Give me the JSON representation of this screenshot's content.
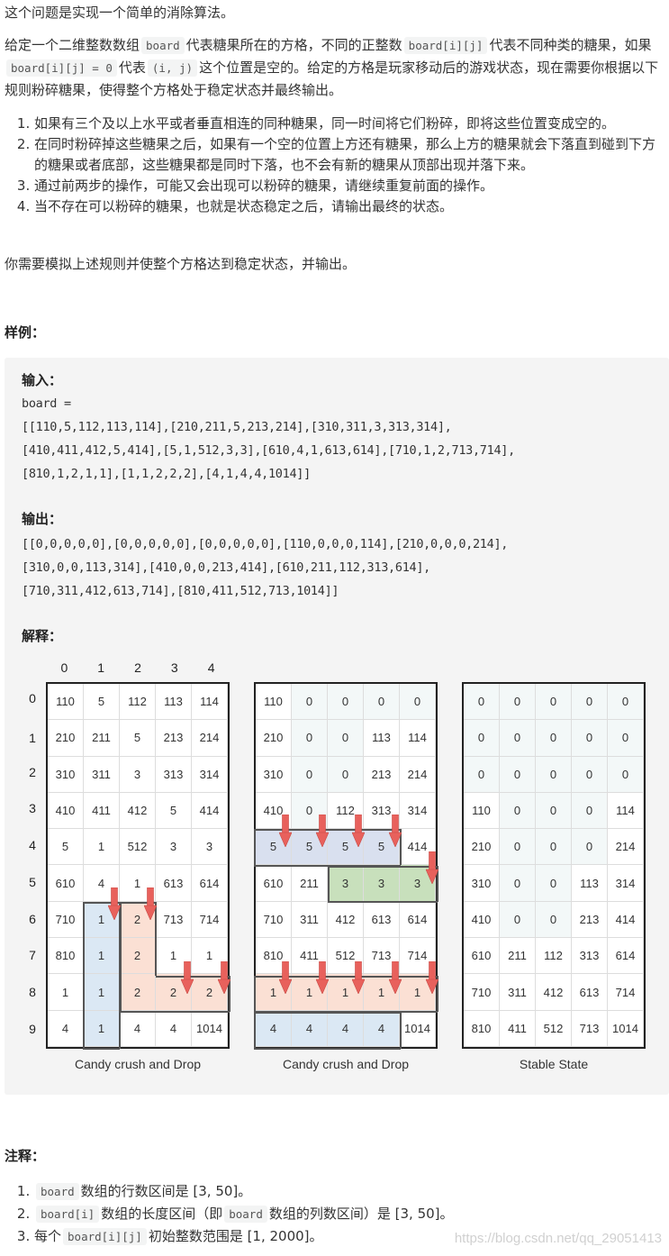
{
  "intro": "这个问题是实现一个简单的消除算法。",
  "desc": {
    "p1": "给定一个二维整数数组",
    "code_board": "board",
    "p2": "代表糖果所在的方格，不同的正整数",
    "code_bij": "board[i][j]",
    "p3": "代表不同种类的糖果，如果",
    "code_eq0": "board[i][j] = 0",
    "p4": "代表",
    "code_ij": "(i, j)",
    "p5": "这个位置是空的。给定的方格是玩家移动后的游戏状态，现在需要你根据以下规则粉碎糖果，使得整个方格处于稳定状态并最终输出。"
  },
  "rules": [
    "如果有三个及以上水平或者垂直相连的同种糖果，同一时间将它们粉碎，即将这些位置变成空的。",
    "在同时粉碎掉这些糖果之后，如果有一个空的位置上方还有糖果，那么上方的糖果就会下落直到碰到下方的糖果或者底部，这些糖果都是同时下落，也不会有新的糖果从顶部出现并落下来。",
    "通过前两步的操作，可能又会出现可以粉碎的糖果，请继续重复前面的操作。",
    "当不存在可以粉碎的糖果，也就是状态稳定之后，请输出最终的状态。"
  ],
  "summary": "你需要模拟上述规则并使整个方格达到稳定状态，并输出。",
  "example_heading": "样例：",
  "example": {
    "input_label": "输入：",
    "input_lines": [
      "board =",
      "[[110,5,112,113,114],[210,211,5,213,214],[310,311,3,313,314],",
      "[410,411,412,5,414],[5,1,512,3,3],[610,4,1,613,614],[710,1,2,713,714],",
      "[810,1,2,1,1],[1,1,2,2,2],[4,1,4,4,1014]]"
    ],
    "output_label": "输出：",
    "output_lines": [
      "[[0,0,0,0,0],[0,0,0,0,0],[0,0,0,0,0],[110,0,0,0,114],[210,0,0,0,214],",
      "[310,0,0,113,314],[410,0,0,213,414],[610,211,112,313,614],",
      "[710,311,412,613,714],[810,411,512,713,1014]]"
    ],
    "explain_label": "解释："
  },
  "figure": {
    "col_indices": [
      "0",
      "1",
      "2",
      "3",
      "4"
    ],
    "row_indices": [
      "0",
      "1",
      "2",
      "3",
      "4",
      "5",
      "6",
      "7",
      "8",
      "9"
    ],
    "colors": {
      "blue": "#dbe8f4",
      "purple": "#d9e0ef",
      "pink": "#fbe0d4",
      "green": "#c8e0bc",
      "arrow": "#e8615c",
      "zero": "#f3f8f8"
    },
    "grids": [
      {
        "caption": "Candy crush and Drop",
        "cells": [
          [
            "110",
            "5",
            "112",
            "113",
            "114"
          ],
          [
            "210",
            "211",
            "5",
            "213",
            "214"
          ],
          [
            "310",
            "311",
            "3",
            "313",
            "314"
          ],
          [
            "410",
            "411",
            "412",
            "5",
            "414"
          ],
          [
            "5",
            "1",
            "512",
            "3",
            "3"
          ],
          [
            "610",
            "4",
            "1",
            "613",
            "614"
          ],
          [
            "710",
            "1",
            "2",
            "713",
            "714"
          ],
          [
            "810",
            "1",
            "2",
            "1",
            "1"
          ],
          [
            "1",
            "1",
            "2",
            "2",
            "2"
          ],
          [
            "4",
            "1",
            "4",
            "4",
            "1014"
          ]
        ],
        "highlights": [
          {
            "color": "blue",
            "cells": [
              [
                6,
                1
              ],
              [
                7,
                1
              ],
              [
                8,
                1
              ],
              [
                9,
                1
              ]
            ]
          },
          {
            "color": "pink",
            "cells": [
              [
                6,
                2
              ],
              [
                7,
                2
              ],
              [
                8,
                2
              ],
              [
                8,
                3
              ],
              [
                8,
                4
              ]
            ]
          }
        ],
        "arrows": [
          [
            5,
            1
          ],
          [
            5,
            2
          ],
          [
            7,
            3
          ],
          [
            7,
            4
          ]
        ]
      },
      {
        "caption": "Candy crush and Drop",
        "cells": [
          [
            "110",
            "0",
            "0",
            "0",
            "0"
          ],
          [
            "210",
            "0",
            "0",
            "113",
            "114"
          ],
          [
            "310",
            "0",
            "0",
            "213",
            "214"
          ],
          [
            "410",
            "0",
            "112",
            "313",
            "314"
          ],
          [
            "5",
            "5",
            "5",
            "5",
            "414"
          ],
          [
            "610",
            "211",
            "3",
            "3",
            "3"
          ],
          [
            "710",
            "311",
            "412",
            "613",
            "614"
          ],
          [
            "810",
            "411",
            "512",
            "713",
            "714"
          ],
          [
            "1",
            "1",
            "1",
            "1",
            "1"
          ],
          [
            "4",
            "4",
            "4",
            "4",
            "1014"
          ]
        ],
        "highlights": [
          {
            "color": "purple",
            "cells": [
              [
                4,
                0
              ],
              [
                4,
                1
              ],
              [
                4,
                2
              ],
              [
                4,
                3
              ]
            ]
          },
          {
            "color": "green",
            "cells": [
              [
                5,
                2
              ],
              [
                5,
                3
              ],
              [
                5,
                4
              ]
            ]
          },
          {
            "color": "pink",
            "cells": [
              [
                8,
                0
              ],
              [
                8,
                1
              ],
              [
                8,
                2
              ],
              [
                8,
                3
              ],
              [
                8,
                4
              ]
            ]
          },
          {
            "color": "blue",
            "cells": [
              [
                9,
                0
              ],
              [
                9,
                1
              ],
              [
                9,
                2
              ],
              [
                9,
                3
              ]
            ]
          }
        ],
        "arrows": [
          [
            3,
            0
          ],
          [
            3,
            1
          ],
          [
            3,
            2
          ],
          [
            3,
            3
          ],
          [
            4,
            4
          ],
          [
            7,
            0
          ],
          [
            7,
            1
          ],
          [
            7,
            2
          ],
          [
            7,
            3
          ],
          [
            7,
            4
          ]
        ]
      },
      {
        "caption": "Stable State",
        "cells": [
          [
            "0",
            "0",
            "0",
            "0",
            "0"
          ],
          [
            "0",
            "0",
            "0",
            "0",
            "0"
          ],
          [
            "0",
            "0",
            "0",
            "0",
            "0"
          ],
          [
            "110",
            "0",
            "0",
            "0",
            "114"
          ],
          [
            "210",
            "0",
            "0",
            "0",
            "214"
          ],
          [
            "310",
            "0",
            "0",
            "113",
            "314"
          ],
          [
            "410",
            "0",
            "0",
            "213",
            "414"
          ],
          [
            "610",
            "211",
            "112",
            "313",
            "614"
          ],
          [
            "710",
            "311",
            "412",
            "613",
            "714"
          ],
          [
            "810",
            "411",
            "512",
            "713",
            "1014"
          ]
        ],
        "highlights": [],
        "arrows": []
      }
    ]
  },
  "notes_heading": "注释：",
  "notes": {
    "n1_code": "board",
    "n1_text": "数组的行数区间是 [3, 50]。",
    "n2_code": "board[i]",
    "n2_text_a": "数组的长度区间（即",
    "n2_code_b": "board",
    "n2_text_b": "数组的列数区间）是 [3, 50]。",
    "n3_text_a": "每个",
    "n3_code": "board[i][j]",
    "n3_text_b": "初始整数范围是 [1, 2000]。"
  },
  "watermark": "https://blog.csdn.net/qq_29051413"
}
